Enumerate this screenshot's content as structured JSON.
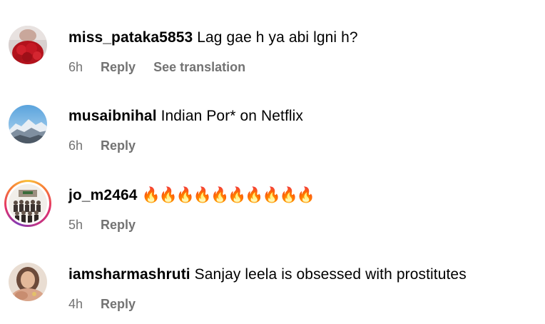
{
  "comments": [
    {
      "username": "miss_pataka5853",
      "text": "Lag gae h ya abi lgni h?",
      "time": "6h",
      "reply_label": "Reply",
      "translation_label": "See translation",
      "avatar_icon": "red-roses-avatar"
    },
    {
      "username": "musaibnihal",
      "text": "Indian Por* on Netflix",
      "time": "6h",
      "reply_label": "Reply",
      "avatar_icon": "snowy-mountain-avatar"
    },
    {
      "username": "jo_m2464",
      "text": "🔥🔥🔥🔥🔥🔥🔥🔥🔥🔥",
      "time": "5h",
      "reply_label": "Reply",
      "avatar_icon": "group-photo-avatar",
      "has_story_ring": true
    },
    {
      "username": "iamsharmashruti",
      "text": "Sanjay leela is obsessed with prostitutes",
      "time": "4h",
      "reply_label": "Reply",
      "avatar_icon": "woman-portrait-avatar"
    }
  ],
  "colors": {
    "meta_text": "#737373",
    "story_ring": [
      "#f9c23c",
      "#f77737",
      "#e1306c",
      "#833ab4"
    ]
  }
}
